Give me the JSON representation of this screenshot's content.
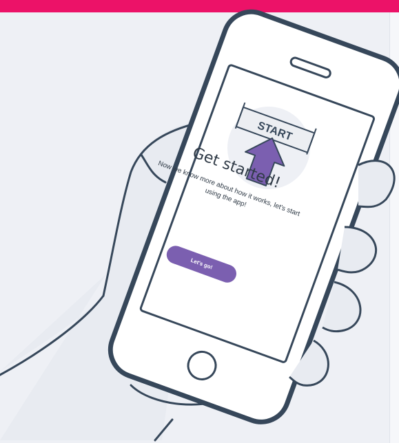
{
  "screen": {
    "banner_label": "START",
    "title": "Get started!",
    "body": "Now we know more about how it works, let's start using the app!",
    "button_label": "Let's go!"
  },
  "colors": {
    "top_bar": "#ec1268",
    "background": "#eef0f5",
    "accent_purple": "#7b5fb0",
    "outline": "#36475a"
  },
  "icons": [
    "start-banner-icon",
    "up-arrow-icon",
    "home-button-icon",
    "speaker-icon"
  ]
}
